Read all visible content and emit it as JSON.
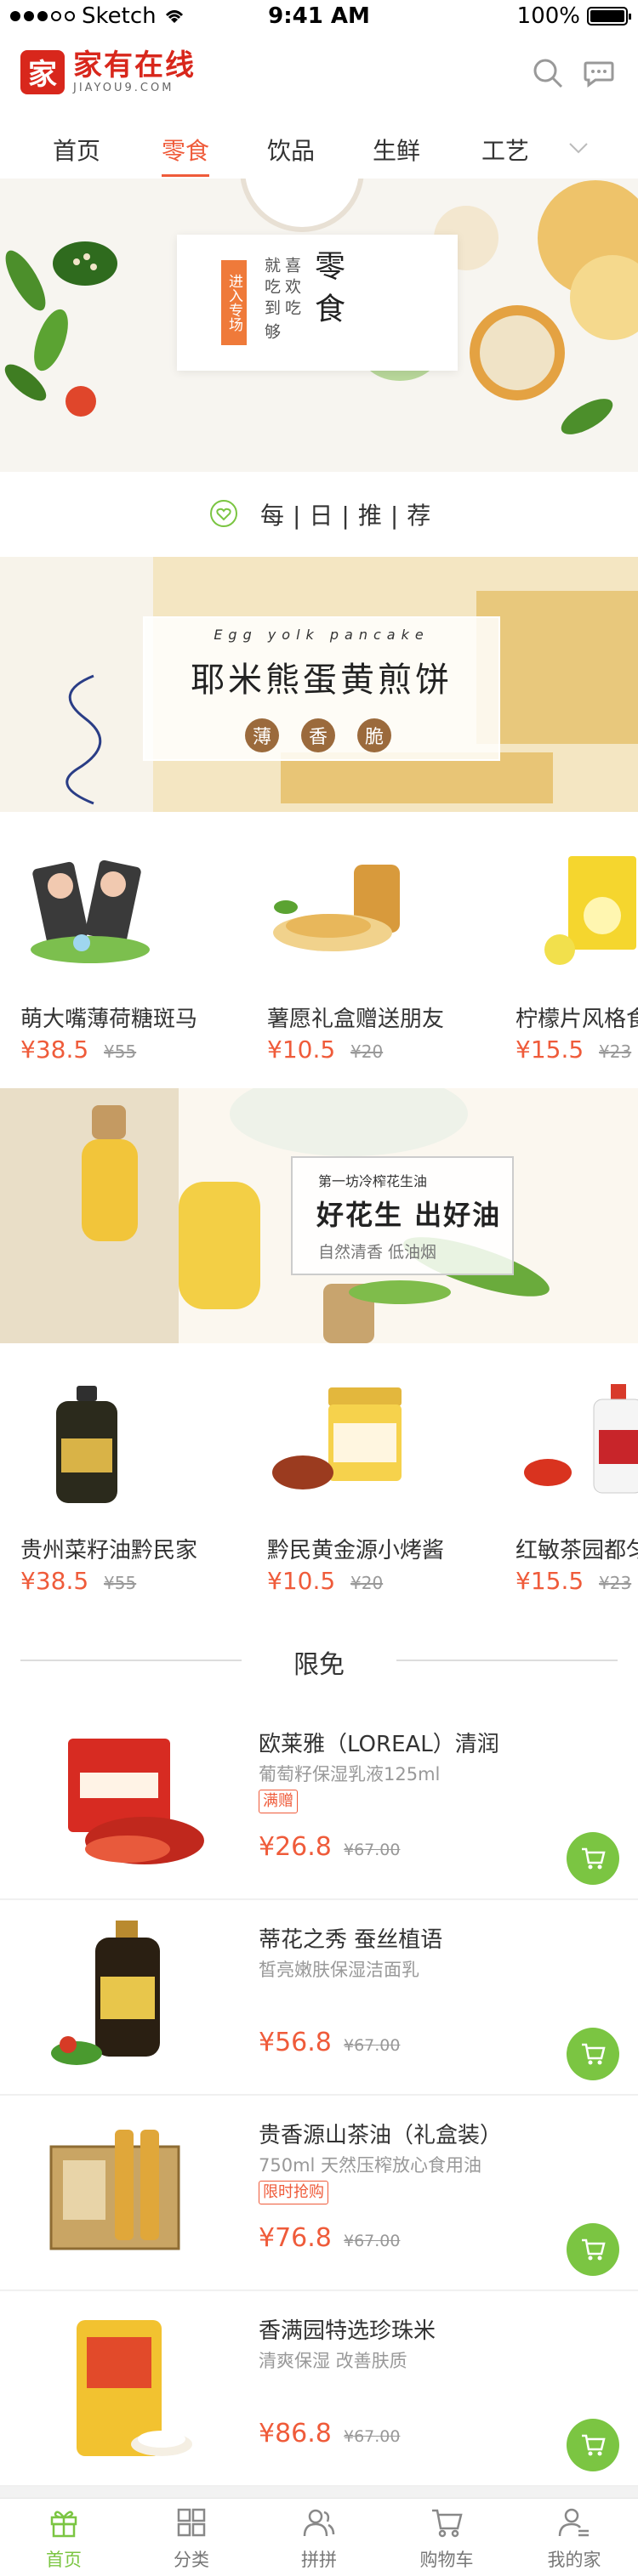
{
  "status_bar": {
    "carrier": "Sketch",
    "time": "9:41 AM",
    "battery": "100%"
  },
  "header": {
    "logo_mark": "家",
    "logo_cn": "家有在线",
    "logo_en": "JIAYOU9.COM",
    "icons": [
      "search-icon",
      "chat-icon"
    ]
  },
  "tabs": [
    {
      "label": "首页",
      "active": false
    },
    {
      "label": "零食",
      "active": true
    },
    {
      "label": "饮品",
      "active": false
    },
    {
      "label": "生鲜",
      "active": false
    },
    {
      "label": "工艺",
      "active": false
    }
  ],
  "hero": {
    "tag": "进入专场",
    "col1": "就吃到",
    "col2": "喜欢吃",
    "col3": "够",
    "big": "零食"
  },
  "daily": {
    "title": "每|日|推|荐"
  },
  "banner_waffle": {
    "en": "Egg yolk pancake",
    "cn": "耶米熊蛋黄煎饼",
    "sub": [
      "薄",
      "香",
      "脆"
    ]
  },
  "products_row1": [
    {
      "name": "萌大嘴薄荷糖斑马",
      "price": "¥38.5",
      "old": "¥55"
    },
    {
      "name": "薯愿礼盒赠送朋友",
      "price": "¥10.5",
      "old": "¥20"
    },
    {
      "name": "柠檬片风格食品",
      "price": "¥15.5",
      "old": "¥23"
    }
  ],
  "banner_oil": {
    "small": "第一坊冷榨花生油",
    "big": "好花生 出好油",
    "sub": "自然清香  低油烟"
  },
  "products_row2": [
    {
      "name": "贵州菜籽油黔民家",
      "price": "¥38.5",
      "old": "¥55"
    },
    {
      "name": "黔民黄金源小烤酱",
      "price": "¥10.5",
      "old": "¥20"
    },
    {
      "name": "红敏茶园都匀",
      "price": "¥15.5",
      "old": "¥23"
    }
  ],
  "limited": {
    "title": "限免"
  },
  "deals": [
    {
      "name": "欧莱雅（LOREAL）清润",
      "desc": "葡萄籽保湿乳液125ml",
      "badge": "满赠",
      "price": "¥26.8",
      "old": "¥67.00"
    },
    {
      "name": "蒂花之秀 蚕丝植语",
      "desc": "皙亮嫩肤保湿洁面乳",
      "badge": "",
      "price": "¥56.8",
      "old": "¥67.00"
    },
    {
      "name": "贵香源山茶油（礼盒装）",
      "desc": "750ml 天然压榨放心食用油",
      "badge": "限时抢购",
      "price": "¥76.8",
      "old": "¥67.00"
    },
    {
      "name": "香满园特选珍珠米",
      "desc": "清爽保湿 改善肤质",
      "badge": "",
      "price": "¥86.8",
      "old": "¥67.00"
    }
  ],
  "tabbar": [
    {
      "label": "首页",
      "icon": "gift-icon",
      "active": true
    },
    {
      "label": "分类",
      "icon": "grid-icon",
      "active": false
    },
    {
      "label": "拼拼",
      "icon": "people-icon",
      "active": false
    },
    {
      "label": "购物车",
      "icon": "cart-icon",
      "active": false
    },
    {
      "label": "我的家",
      "icon": "profile-icon",
      "active": false
    }
  ],
  "colors": {
    "accent": "#ef5b3a",
    "green": "#7bc542",
    "brand": "#d8271c"
  }
}
